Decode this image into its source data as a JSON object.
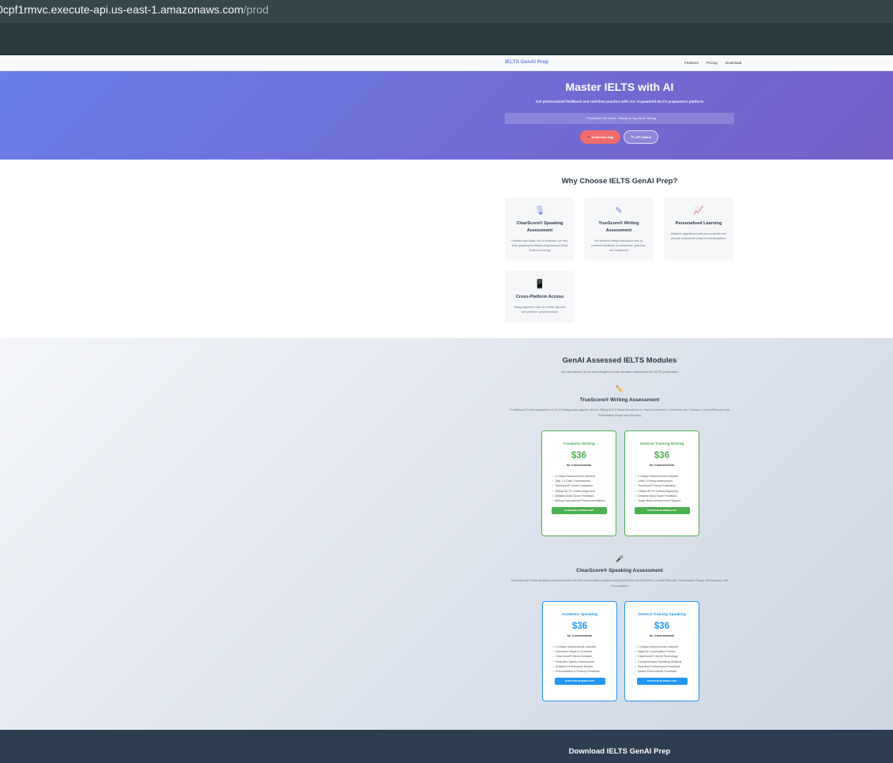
{
  "browser": {
    "url_host": "0cpf1rmvc.execute-api.us-east-1.amazonaws.com",
    "url_path": "/prod"
  },
  "nav": {
    "brand": "IELTS GenAI Prep",
    "links": [
      "Features",
      "Pricing",
      "Download"
    ]
  },
  "hero": {
    "title": "Master IELTS with AI",
    "subtitle": "Get personalized feedback and real-time practice with our AI-powered IELTS preparation platform",
    "status_check": "✓",
    "status": "Production API Active - Ready for App Store Testing",
    "download_button": "📥 Download App",
    "api_button": "📡 API Status"
  },
  "features": {
    "heading": "Why Choose IELTS GenAI Prep?",
    "cards": [
      {
        "icon": "microphone-icon",
        "glyph": "🎙",
        "title": "ClearScore® Speaking Assessment",
        "desc": "Practice with Maya, our AI examiner, for real-time speaking feedback using Amazon Nova Sonic technology"
      },
      {
        "icon": "edit-icon",
        "glyph": "✎",
        "title": "TrueScore® Writing Assessment",
        "desc": "Get detailed writing evaluations with AI-powered feedback on coherence, grammar, and vocabulary"
      },
      {
        "icon": "chart-line-icon",
        "glyph": "📈",
        "title": "Personalized Learning",
        "desc": "Adaptive algorithms track your progress and provide customized study recommendations"
      },
      {
        "icon": "mobile-icon",
        "glyph": "📱",
        "title": "Cross-Platform Access",
        "desc": "Study anywhere with our mobile app and web platform synchronization"
      }
    ]
  },
  "modules": {
    "heading": "GenAI Assessed IELTS Modules",
    "subheading": "Our specialized GenAI technologies provide accurate assessment for IELTS preparation",
    "writing": {
      "icon": "pencil-icon",
      "glyph": "✏️",
      "title": "TrueScore® Writing Assessment",
      "desc": "Professional GenAI assessment of IELTS writing tasks aligned with the Official IELTS Band Descriptors on Task Achievement, Coherence and Cohesion, Lexical Resource and Grammatical Range and Accuracy",
      "plans": [
        {
          "title": "Academic Writing",
          "price": "$36",
          "for": "for 4 assessments",
          "features": [
            "4 Unique Assessments Included",
            "Task 1 & Task 2 Assessment",
            "TrueScore® GenAI Evaluation",
            "Official IELTS Criteria Alignment",
            "Detailed Band Score Feedback",
            "Writing Improvement Recommendations"
          ],
          "cta": "PURCHASE IN MOBILE APP"
        },
        {
          "title": "General Training Writing",
          "price": "$36",
          "for": "for 4 assessments",
          "features": [
            "4 Unique Assessments Included",
            "Letter & Essay Assessment",
            "TrueScore® GenAI Evaluation",
            "Official IELTS Criteria Alignment",
            "Detailed Band Score Feedback",
            "Target Band Achievement Support"
          ],
          "cta": "PURCHASE IN MOBILE APP"
        }
      ]
    },
    "speaking": {
      "icon": "microphone-icon",
      "glyph": "🎤",
      "title": "ClearScore® Speaking Assessment",
      "desc": "Revolutionary GenAI speaking assessment with real-time conversation analysis covering Fluency and Coherence, Lexical Resource, Grammatical Range and Accuracy, and Pronunciation",
      "plans": [
        {
          "title": "Academic Speaking",
          "price": "$36",
          "for": "for 4 assessments",
          "features": [
            "4 Unique Assessments Included",
            "Interactive Maya AI Examiner",
            "ClearScore® GenAI Analysis",
            "Real-time Speech Assessment",
            "Detailed Performance Metrics",
            "Pronunciation & Fluency Feedback"
          ],
          "cta": "PURCHASE IN MOBILE APP"
        },
        {
          "title": "General Training Speaking",
          "price": "$36",
          "for": "for 4 assessments",
          "features": [
            "4 Unique Assessments Included",
            "Maya AI Conversation Partner",
            "ClearScore® GenAI Technology",
            "Comprehensive Speaking Analysis",
            "Real-time Performance Feedback",
            "Instant Performance Feedback"
          ],
          "cta": "PURCHASE IN MOBILE APP"
        }
      ]
    }
  },
  "footer": {
    "heading": "Download IELTS GenAI Prep"
  },
  "colors": {
    "brand": "#667eea",
    "hero_start": "#6a7de8",
    "hero_end": "#7560c7",
    "download_button": "#f06b6b",
    "writing_accent": "#4caf50",
    "speaking_accent": "#2196f3",
    "footer": "#2c3e50"
  }
}
